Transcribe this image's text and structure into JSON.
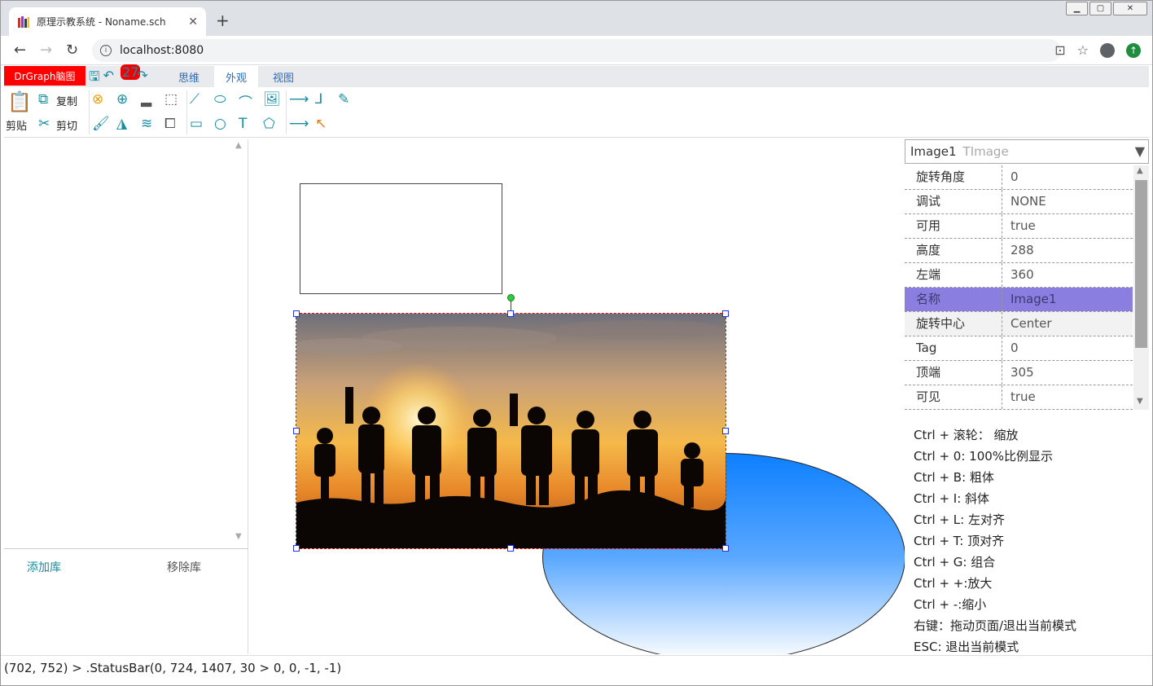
{
  "browser": {
    "tab_title": "原理示教系统 - Noname.sch",
    "url": "localhost:8080",
    "new_tab": "+",
    "close_tab": "✕"
  },
  "app": {
    "brand": "DrGraph脑图",
    "undo_badge": "27",
    "ribbon_tabs": [
      "思维",
      "外观",
      "视图"
    ],
    "active_tab": "外观",
    "paste_label": "剪贴",
    "copy_label": "复制",
    "cut_label": "剪切"
  },
  "left_panel": {
    "add_library": "添加库",
    "remove_library": "移除库"
  },
  "properties": {
    "object_name": "Image1",
    "object_type": "TImage",
    "rows": [
      {
        "key": "旋转角度",
        "value": "0"
      },
      {
        "key": "调试",
        "value": "NONE"
      },
      {
        "key": "可用",
        "value": "true"
      },
      {
        "key": "高度",
        "value": "288"
      },
      {
        "key": "左端",
        "value": "360"
      },
      {
        "key": "名称",
        "value": "Image1"
      },
      {
        "key": "旋转中心",
        "value": "Center"
      },
      {
        "key": "Tag",
        "value": "0"
      },
      {
        "key": "顶端",
        "value": "305"
      },
      {
        "key": "可见",
        "value": "true"
      }
    ],
    "selected_row": 5
  },
  "help": [
    "Ctrl + 滚轮： 缩放",
    "Ctrl + 0: 100%比例显示",
    "Ctrl + B: 粗体",
    "Ctrl + I: 斜体",
    "Ctrl + L: 左对齐",
    "Ctrl + T: 顶对齐",
    "Ctrl + G: 组合",
    "Ctrl + +:放大",
    "Ctrl + -:缩小",
    "右键：拖动页面/退出当前模式",
    "ESC: 退出当前模式"
  ],
  "status_text": "(702, 752) > .StatusBar(0, 724, 1407, 30 > 0, 0, -1, -1)",
  "colors": {
    "brand_bg": "#ff0000",
    "icon": "#1a8ca0",
    "selected_row": "#8a7fe0",
    "selection_outline": "#ee0000",
    "handle": "#2233ee",
    "ellipse_top": "#0d7fff"
  }
}
